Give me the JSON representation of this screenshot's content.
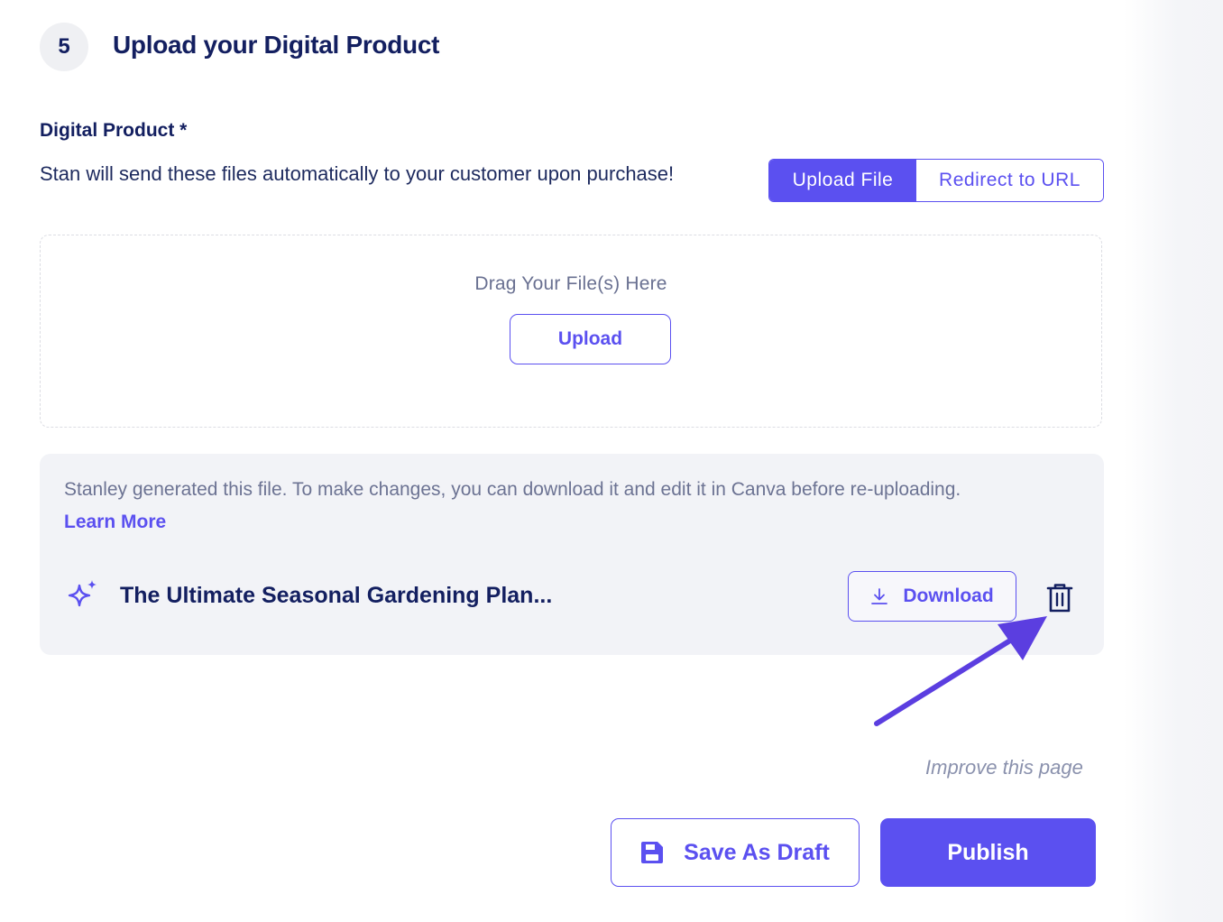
{
  "section": {
    "step_number": "5",
    "title": "Upload your Digital Product"
  },
  "field": {
    "label": "Digital Product *",
    "description": "Stan will send these files automatically to your customer upon purchase!"
  },
  "delivery_toggle": {
    "options": [
      "Upload File",
      "Redirect to URL"
    ],
    "selected": "Upload File"
  },
  "dropzone": {
    "prompt": "Drag Your File(s) Here",
    "button_label": "Upload"
  },
  "generated_file": {
    "notice": "Stanley generated this file. To make changes, you can download it and edit it in Canva before re-uploading.",
    "learn_more_label": "Learn More",
    "file_name": "The Ultimate Seasonal Gardening Plan...",
    "download_label": "Download"
  },
  "footer": {
    "improve_link": "Improve this page",
    "save_draft_label": "Save As Draft",
    "publish_label": "Publish"
  },
  "colors": {
    "accent": "#5b50f0",
    "text_dark": "#131f60",
    "card_bg": "#f2f3f7"
  },
  "icons": {
    "generated": "sparkle-icon",
    "download": "download-icon",
    "delete": "trash-icon",
    "save": "floppy-disk-icon",
    "annotation": "arrow"
  }
}
